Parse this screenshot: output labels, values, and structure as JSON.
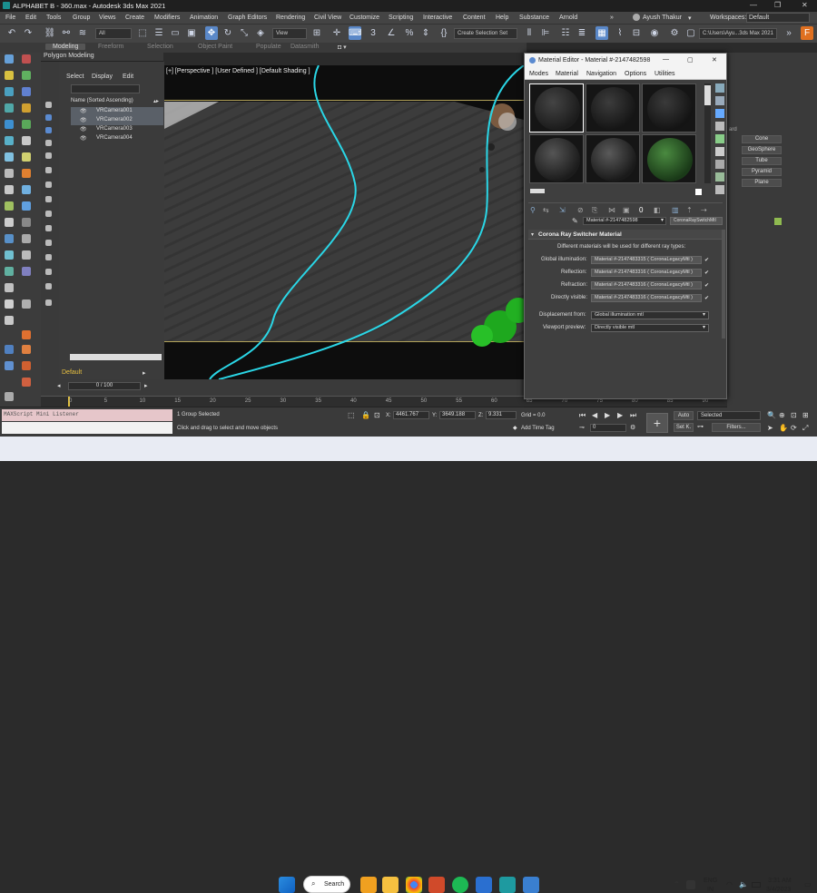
{
  "window": {
    "title": "ALPHABET B - 360.max - Autodesk 3ds Max 2021"
  },
  "menubar": [
    "File",
    "Edit",
    "Tools",
    "Group",
    "Views",
    "Create",
    "Modifiers",
    "Animation",
    "Graph Editors",
    "Rendering",
    "Civil View",
    "Customize",
    "Scripting",
    "Interactive",
    "Content",
    "Help",
    "Substance",
    "Arnold"
  ],
  "user": {
    "name": "Ayush Thakur",
    "workspaces_label": "Workspaces:",
    "workspace": "Default"
  },
  "toolbar": {
    "filter": "All",
    "view": "View",
    "selection_set": "Create Selection Set",
    "path": "C:\\Users\\Ayu...3ds Max 2021"
  },
  "ribbon": {
    "tabs": [
      "Modeling",
      "Freeform",
      "Selection",
      "Object Paint",
      "Populate",
      "Datasmith"
    ],
    "active": "Modeling",
    "sub": "Polygon Modeling"
  },
  "scene_explorer": {
    "menu": [
      "Select",
      "Display",
      "Edit"
    ],
    "header": "Name (Sorted Ascending)",
    "items": [
      "VRCamera001",
      "VRCamera002",
      "VRCamera003",
      "VRCamera004"
    ],
    "layer": "Default"
  },
  "viewport": {
    "label": "[+] [Perspective ] [User Defined ] [Default Shading ]"
  },
  "time": {
    "counter": "0 / 100",
    "ticks": [
      "0",
      "5",
      "10",
      "15",
      "20",
      "25",
      "30",
      "35",
      "40",
      "45",
      "50",
      "55",
      "60",
      "65",
      "70",
      "75",
      "80",
      "85",
      "90",
      "95",
      "100"
    ]
  },
  "status": {
    "selection": "1 Group Selected",
    "prompt": "Click and drag to select and move objects",
    "listener": "MAXScript Mini Listener",
    "x_label": "X:",
    "x": "4461.767",
    "y_label": "Y:",
    "y": "3649.188",
    "z_label": "Z:",
    "z": "9.331",
    "grid": "Grid = 0.0",
    "add_time_tag": "Add Time Tag",
    "auto": "Auto",
    "set_k": "Set K.",
    "selected": "Selected",
    "filters": "Filters...",
    "frame": "0"
  },
  "material_editor": {
    "title": "Material Editor - Material #-2147482598",
    "menu": [
      "Modes",
      "Material",
      "Navigation",
      "Options",
      "Utilities"
    ],
    "material_name": "Material #-2147482598",
    "material_type": "CoronaRaySwitchMtl",
    "rollout_title": "Corona Ray Switcher Material",
    "description": "Different materials will be used for different ray types:",
    "params": [
      {
        "label": "Global illumination:",
        "value": "Material #-2147483315  ( CoronaLegacyMtl )"
      },
      {
        "label": "Reflection:",
        "value": "Material #-2147483316  ( CoronaLegacyMtl )"
      },
      {
        "label": "Refraction:",
        "value": "Material #-2147483316  ( CoronaLegacyMtl )"
      },
      {
        "label": "Directly visible:",
        "value": "Material #-2147483316  ( CoronaLegacyMtl )"
      }
    ],
    "displacement_label": "Displacement from:",
    "displacement_value": "Global illumination mtl",
    "viewport_label": "Viewport preview:",
    "viewport_value": "Directly visible mtl"
  },
  "command_panel": {
    "buttons": [
      "Cone",
      "GeoSphere",
      "Tube",
      "Pyramid",
      "Plane"
    ],
    "partial_label": "ard"
  },
  "taskbar": {
    "search": "Search",
    "lang1": "ENG",
    "lang2": "IN",
    "time": "3:31 AM",
    "date": "3/4/2023"
  }
}
